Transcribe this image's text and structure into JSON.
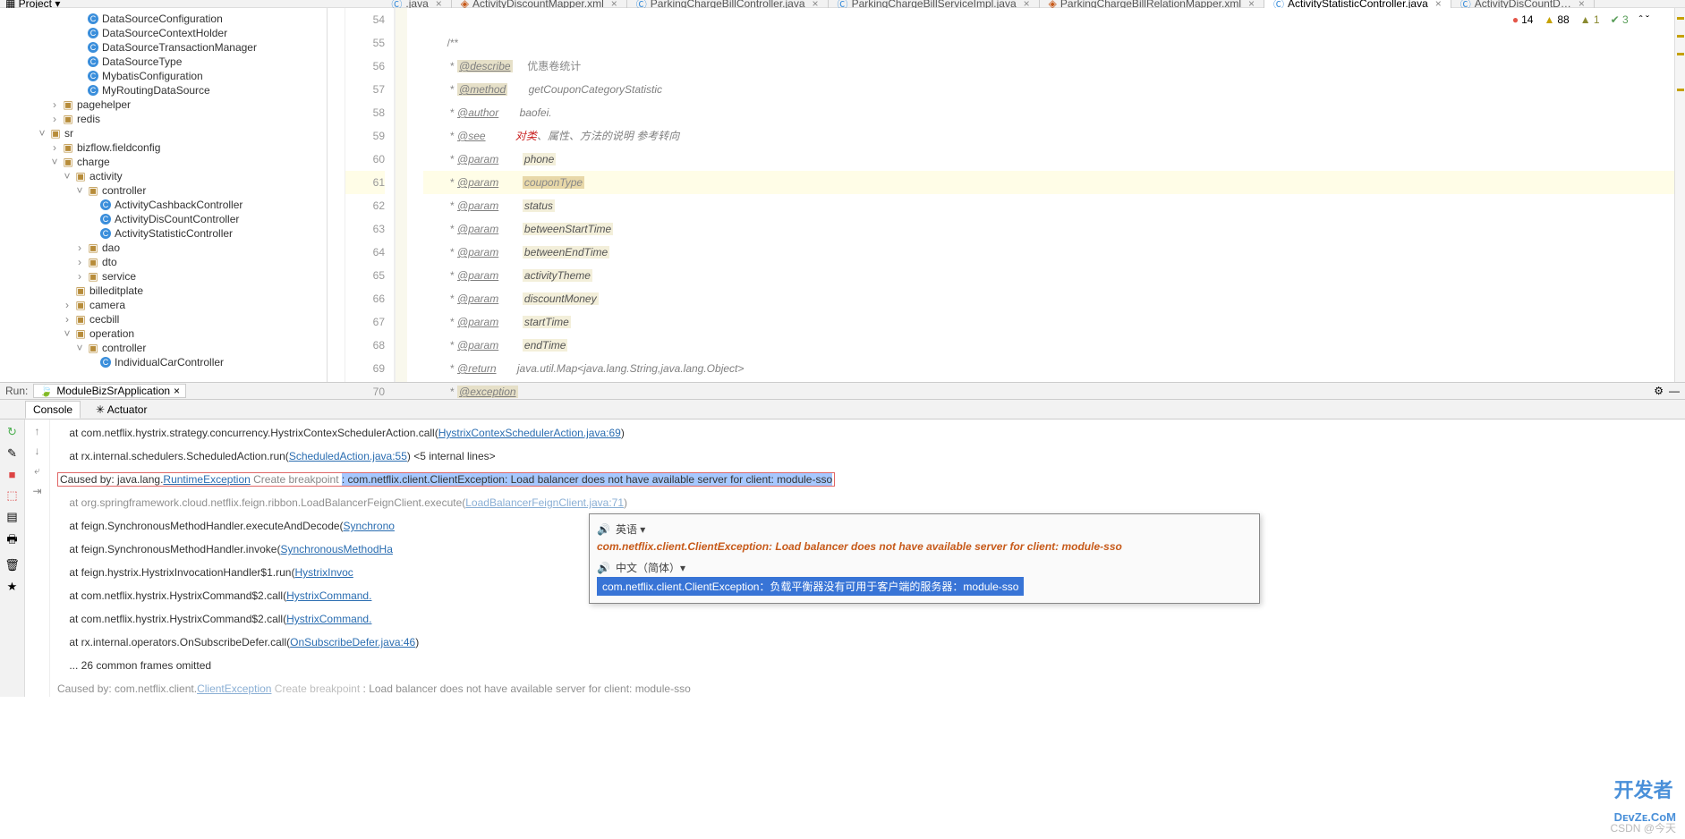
{
  "topbar": {
    "project_label": "Project",
    "tabs": [
      {
        "label": ".java",
        "active": false,
        "icon": "java"
      },
      {
        "label": "ActivityDiscountMapper.xml",
        "active": false,
        "icon": "xml"
      },
      {
        "label": "ParkingChargeBillController.java",
        "active": false,
        "icon": "java"
      },
      {
        "label": "ParkingChargeBillServiceImpl.java",
        "active": false,
        "icon": "java"
      },
      {
        "label": "ParkingChargeBillRelationMapper.xml",
        "active": false,
        "icon": "xml"
      },
      {
        "label": "ActivityStatisticController.java",
        "active": true,
        "icon": "java"
      },
      {
        "label": "ActivityDisCountD…",
        "active": false,
        "icon": "java"
      }
    ]
  },
  "status": {
    "err": "14",
    "warn": "88",
    "weakwarn": "1",
    "info": "3",
    "up_down": "ˆ ˇ"
  },
  "tree": {
    "root": "Project",
    "items": [
      {
        "indent": 6,
        "icon": "cls",
        "label": "DataSourceConfiguration"
      },
      {
        "indent": 6,
        "icon": "cls",
        "label": "DataSourceContextHolder"
      },
      {
        "indent": 6,
        "icon": "cls",
        "label": "DataSourceTransactionManager"
      },
      {
        "indent": 6,
        "icon": "cls",
        "label": "DataSourceType"
      },
      {
        "indent": 6,
        "icon": "cls",
        "label": "MybatisConfiguration"
      },
      {
        "indent": 6,
        "icon": "cls",
        "label": "MyRoutingDataSource"
      },
      {
        "indent": 4,
        "arrow": ">",
        "icon": "pkg",
        "label": "pagehelper"
      },
      {
        "indent": 4,
        "arrow": ">",
        "icon": "pkg",
        "label": "redis"
      },
      {
        "indent": 3,
        "arrow": "v",
        "icon": "pkg",
        "label": "sr"
      },
      {
        "indent": 4,
        "arrow": ">",
        "icon": "pkg",
        "label": "bizflow.fieldconfig"
      },
      {
        "indent": 4,
        "arrow": "v",
        "icon": "pkg",
        "label": "charge"
      },
      {
        "indent": 5,
        "arrow": "v",
        "icon": "pkg",
        "label": "activity"
      },
      {
        "indent": 6,
        "arrow": "v",
        "icon": "pkg",
        "label": "controller"
      },
      {
        "indent": 7,
        "icon": "cls",
        "label": "ActivityCashbackController"
      },
      {
        "indent": 7,
        "icon": "cls",
        "label": "ActivityDisCountController"
      },
      {
        "indent": 7,
        "icon": "cls",
        "label": "ActivityStatisticController"
      },
      {
        "indent": 6,
        "arrow": ">",
        "icon": "pkg",
        "label": "dao"
      },
      {
        "indent": 6,
        "arrow": ">",
        "icon": "pkg",
        "label": "dto"
      },
      {
        "indent": 6,
        "arrow": ">",
        "icon": "pkg",
        "label": "service"
      },
      {
        "indent": 5,
        "icon": "pkg",
        "label": "billeditplate"
      },
      {
        "indent": 5,
        "arrow": ">",
        "icon": "pkg",
        "label": "camera"
      },
      {
        "indent": 5,
        "arrow": ">",
        "icon": "pkg",
        "label": "cecbill"
      },
      {
        "indent": 5,
        "arrow": "v",
        "icon": "pkg",
        "label": "operation"
      },
      {
        "indent": 6,
        "arrow": "v",
        "icon": "pkg",
        "label": "controller"
      },
      {
        "indent": 7,
        "icon": "cls",
        "label": "IndividualCarController"
      }
    ]
  },
  "code": {
    "lines": [
      {
        "n": 54,
        "html": ""
      },
      {
        "n": 55,
        "html": "<span class='star'>/**</span>"
      },
      {
        "n": 56,
        "html": "<span class='star'> * </span><span class='tag tagbg'>@describe</span>     <span class='cn'>优惠卷统计</span>"
      },
      {
        "n": 57,
        "html": "<span class='star'> * </span><span class='tag tagbg'>@method</span>       <span class='desc'>getCouponCategoryStatistic</span>"
      },
      {
        "n": 58,
        "html": "<span class='star'> * </span><span class='tag'>@author</span>       <span class='desc'>baofei.</span>"
      },
      {
        "n": 59,
        "html": "<span class='star'> * </span><span class='tag'>@see</span>          <span class='red'>对类</span><span class='desc'>、属性、方法的说明 参考转向</span>"
      },
      {
        "n": 60,
        "html": "<span class='star'> * </span><span class='tag'>@param</span>        <span class='parambg'>phone</span>"
      },
      {
        "n": 61,
        "html": "<span class='star'> * </span><span class='tag'>@param</span>        <span class='paramhl'>couponType</span>",
        "hl": true
      },
      {
        "n": 62,
        "html": "<span class='star'> * </span><span class='tag'>@param</span>        <span class='parambg'>status</span>"
      },
      {
        "n": 63,
        "html": "<span class='star'> * </span><span class='tag'>@param</span>        <span class='parambg'>betweenStartTime</span>"
      },
      {
        "n": 64,
        "html": "<span class='star'> * </span><span class='tag'>@param</span>        <span class='parambg'>betweenEndTime</span>"
      },
      {
        "n": 65,
        "html": "<span class='star'> * </span><span class='tag'>@param</span>        <span class='parambg'>activityTheme</span>"
      },
      {
        "n": 66,
        "html": "<span class='star'> * </span><span class='tag'>@param</span>        <span class='parambg'>discountMoney</span>"
      },
      {
        "n": 67,
        "html": "<span class='star'> * </span><span class='tag'>@param</span>        <span class='parambg'>startTime</span>"
      },
      {
        "n": 68,
        "html": "<span class='star'> * </span><span class='tag'>@param</span>        <span class='parambg'>endTime</span>"
      },
      {
        "n": 69,
        "html": "<span class='star'> * </span><span class='tag'>@return</span>       <span class='desc'>java.util.Map&lt;java.lang.String,java.lang.Object&gt;</span>"
      },
      {
        "n": 70,
        "html": "<span class='star'> * </span><span class='tag tagbg'>@exception</span>"
      }
    ]
  },
  "run": {
    "label": "Run:",
    "app": "ModuleBizSrApplication"
  },
  "tabs2": {
    "console": "Console",
    "actuator": "Actuator"
  },
  "console": {
    "lines": [
      {
        "t": "    at com.netflix.hystrix.strategy.concurrency.HystrixContexSchedulerAction.call(",
        "link": "HystrixContexSchedulerAction.java:69",
        "tail": ")"
      },
      {
        "t": "    at rx.internal.schedulers.ScheduledAction.run(",
        "link": "ScheduledAction.java:55",
        "tail": ") <5 internal lines>"
      },
      {
        "caused": true,
        "pre": "Caused by: java.lang.",
        "linkex": "RuntimeException",
        "bp": " Create breakpoint ",
        "sel": ": com.netflix.client.ClientException: Load balancer does not have available server for client: module-sso"
      },
      {
        "t": "    at org.springframework.cloud.netflix.feign.ribbon.LoadBalancerFeignClient.execute(",
        "link": "LoadBalancerFeignClient.java:71",
        "tail": ")",
        "dim": true
      },
      {
        "t": "    at feign.SynchronousMethodHandler.executeAndDecode(",
        "link": "Synchrono",
        "tail": ""
      },
      {
        "t": "    at feign.SynchronousMethodHandler.invoke(",
        "link": "SynchronousMethodHa",
        "tail": ""
      },
      {
        "t": "    at feign.hystrix.HystrixInvocationHandler$1.run(",
        "link": "HystrixInvoc",
        "tail": ""
      },
      {
        "t": "    at com.netflix.hystrix.HystrixCommand$2.call(",
        "link": "HystrixCommand.",
        "tail": ""
      },
      {
        "t": "    at com.netflix.hystrix.HystrixCommand$2.call(",
        "link": "HystrixCommand.",
        "tail": ""
      },
      {
        "t": "    at rx.internal.operators.OnSubscribeDefer.call(",
        "link": "OnSubscribeDefer.java:46",
        "tail": ")"
      },
      {
        "t": "    ... 26 common frames omitted"
      },
      {
        "caused": true,
        "pre": "Caused by: com.netflix.client.",
        "linkex": "ClientException",
        "bp": " Create breakpoint ",
        "plain": ": Load balancer does not have available server for client: module-sso",
        "dim": true
      }
    ]
  },
  "popup": {
    "lang_en": "英语 ▾",
    "en": "com.netflix.client.ClientException: Load balancer does not have available server for client: module-sso",
    "lang_zh": "中文（简体）▾",
    "zh": "com.netflix.client.ClientException：负载平衡器没有可用于客户端的服务器：module-sso"
  },
  "watermark": "CSDN @今天",
  "logo": "开发者\nDevZe.CoM"
}
